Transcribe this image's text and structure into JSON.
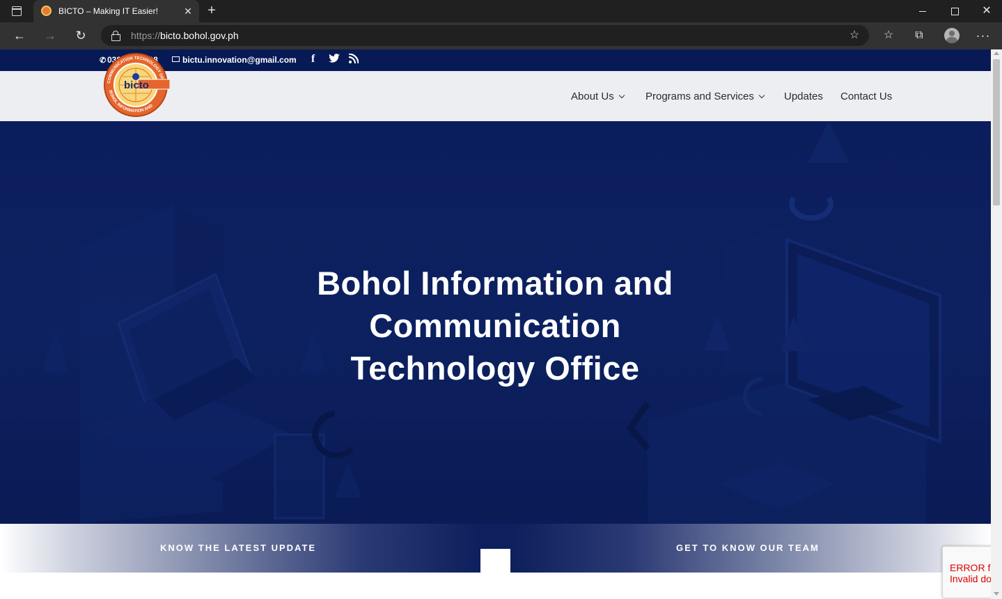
{
  "browser": {
    "tab_title": "BICTO – Making IT Easier!",
    "tab_close": "✕",
    "new_tab": "+",
    "url_scheme": "https://",
    "url_host": "bicto.bohol.gov.ph",
    "icons": [
      "tab-actions-icon",
      "favicon",
      "close-icon",
      "plus-icon",
      "minimize-icon",
      "maximize-icon",
      "close-window-icon",
      "back-icon",
      "forward-icon",
      "reload-icon",
      "lock-icon",
      "add-favorite-icon",
      "favorites-icon",
      "collections-icon",
      "profile-icon",
      "more-icon"
    ]
  },
  "topbar": {
    "phone": "038.411.0138",
    "email": "bictu.innovation@gmail.com",
    "social": [
      "facebook-icon",
      "twitter-icon",
      "rss-icon"
    ]
  },
  "header": {
    "logo_text": "bicto",
    "logo_ring_text": "BOHOL INFORMATION AND COMMUNICATION TECHNOLOGY OFFICE",
    "menu": {
      "about": "About Us",
      "programs": "Programs and Services",
      "updates": "Updates",
      "contact": "Contact Us"
    }
  },
  "hero": {
    "title_line1": "Bohol Information and",
    "title_line2": "Communication",
    "title_line3": "Technology Office"
  },
  "cta": {
    "left": "KNOW THE LATEST UPDATE",
    "right": "GET TO KNOW OUR TEAM"
  },
  "recaptcha": {
    "line1": "ERROR for",
    "line2": "Invalid do"
  },
  "colors": {
    "topbar": "#081a55",
    "hero": "#0b1d5c",
    "header_bg": "#eceef2",
    "logo_orange": "#e5662d",
    "logo_yellow": "#f2c94c",
    "error_red": "#dd0000"
  }
}
